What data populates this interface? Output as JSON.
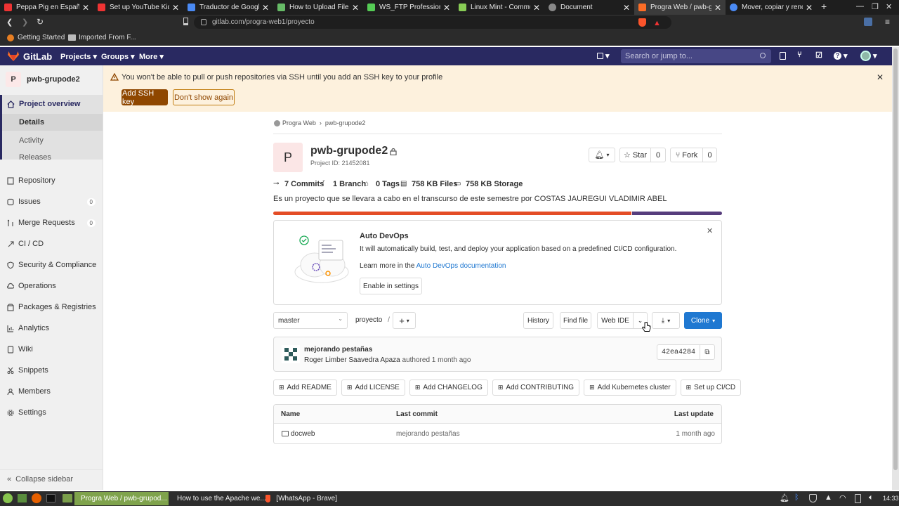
{
  "browser": {
    "tabs": [
      {
        "title": "Peppa Pig en Español |",
        "color": "#e33"
      },
      {
        "title": "Set up YouTube Kids",
        "color": "#e33"
      },
      {
        "title": "Traductor de Google",
        "color": "#4a8af4"
      },
      {
        "title": "How to Upload Files to",
        "color": "#6b6"
      },
      {
        "title": "WS_FTP Professional -",
        "color": "#5c5"
      },
      {
        "title": "Linux Mint - Community",
        "color": "#8c5"
      },
      {
        "title": "Document",
        "color": "#888"
      },
      {
        "title": "Progra Web / pwb-gru",
        "color": "#fc6d26"
      },
      {
        "title": "Mover, copiar y renom",
        "color": "#4a8af4"
      }
    ],
    "url": "gitlab.com/progra-web1/proyecto",
    "bookmarks": [
      "Getting Started",
      "Imported From F..."
    ]
  },
  "gitlab": {
    "brand": "GitLab",
    "nav": [
      "Projects",
      "Groups",
      "More"
    ],
    "search_placeholder": "Search or jump to..."
  },
  "sidebar": {
    "project_initial": "P",
    "project_name": "pwb-grupode2",
    "overview": "Project overview",
    "subitems": [
      "Details",
      "Activity",
      "Releases"
    ],
    "items": [
      {
        "label": "Repository",
        "icon": "book-icon"
      },
      {
        "label": "Issues",
        "icon": "issues-icon",
        "count": "0"
      },
      {
        "label": "Merge Requests",
        "icon": "merge-request-icon",
        "count": "0"
      },
      {
        "label": "CI / CD",
        "icon": "rocket-icon"
      },
      {
        "label": "Security & Compliance",
        "icon": "shield-icon"
      },
      {
        "label": "Operations",
        "icon": "cloud-gear-icon"
      },
      {
        "label": "Packages & Registries",
        "icon": "package-icon"
      },
      {
        "label": "Analytics",
        "icon": "chart-icon"
      },
      {
        "label": "Wiki",
        "icon": "book-icon"
      },
      {
        "label": "Snippets",
        "icon": "scissors-icon"
      },
      {
        "label": "Members",
        "icon": "users-icon"
      },
      {
        "label": "Settings",
        "icon": "gear-icon"
      }
    ],
    "collapse": "Collapse sidebar"
  },
  "banner": {
    "message": "You won't be able to pull or push repositories via SSH until you add an SSH key to your profile",
    "add_ssh": "Add SSH key",
    "dont_show": "Don't show again"
  },
  "breadcrumb": [
    "Progra Web",
    "pwb-grupode2"
  ],
  "project": {
    "avatar": "P",
    "name": "pwb-grupode2",
    "id_text": "Project ID: 21452081",
    "star": "Star",
    "star_count": "0",
    "fork": "Fork",
    "fork_count": "0",
    "commits": "7 Commits",
    "branches": "1 Branch",
    "tags": "0 Tags",
    "files": "758 KB Files",
    "storage": "758 KB Storage",
    "description": "Es un proyecto que se llevara a cabo en el transcurso de este semestre por COSTAS JAUREGUI VLADIMIR ABEL",
    "language_bar": [
      {
        "percent": 80,
        "color": "#e44d26"
      },
      {
        "percent": 20,
        "color": "#563d7c"
      }
    ]
  },
  "devops": {
    "title": "Auto DevOps",
    "text": "It will automatically build, test, and deploy your application based on a predefined CI/CD configuration.",
    "learn_prefix": "Learn more in the",
    "learn_link": "Auto DevOps documentation",
    "enable": "Enable in settings"
  },
  "repo": {
    "branch": "master",
    "path": "proyecto",
    "separator": "/",
    "history": "History",
    "find_file": "Find file",
    "web_ide": "Web IDE",
    "clone": "Clone"
  },
  "commit": {
    "title": "mejorando pestañas",
    "author": "Roger Limber Saavedra Apaza",
    "authored": "authored 1 month ago",
    "sha": "42ea4284"
  },
  "quick_actions": [
    "Add README",
    "Add LICENSE",
    "Add CHANGELOG",
    "Add CONTRIBUTING",
    "Add Kubernetes cluster",
    "Set up CI/CD"
  ],
  "table": {
    "headers": [
      "Name",
      "Last commit",
      "Last update"
    ],
    "rows": [
      {
        "name": "docweb",
        "commit": "mejorando pestañas",
        "updated": "1 month ago"
      }
    ]
  },
  "taskbar": {
    "apps": [
      "Progra Web / pwb-grupod...",
      "How to use the Apache we...",
      "[WhatsApp - Brave]"
    ],
    "time": "14:33"
  }
}
